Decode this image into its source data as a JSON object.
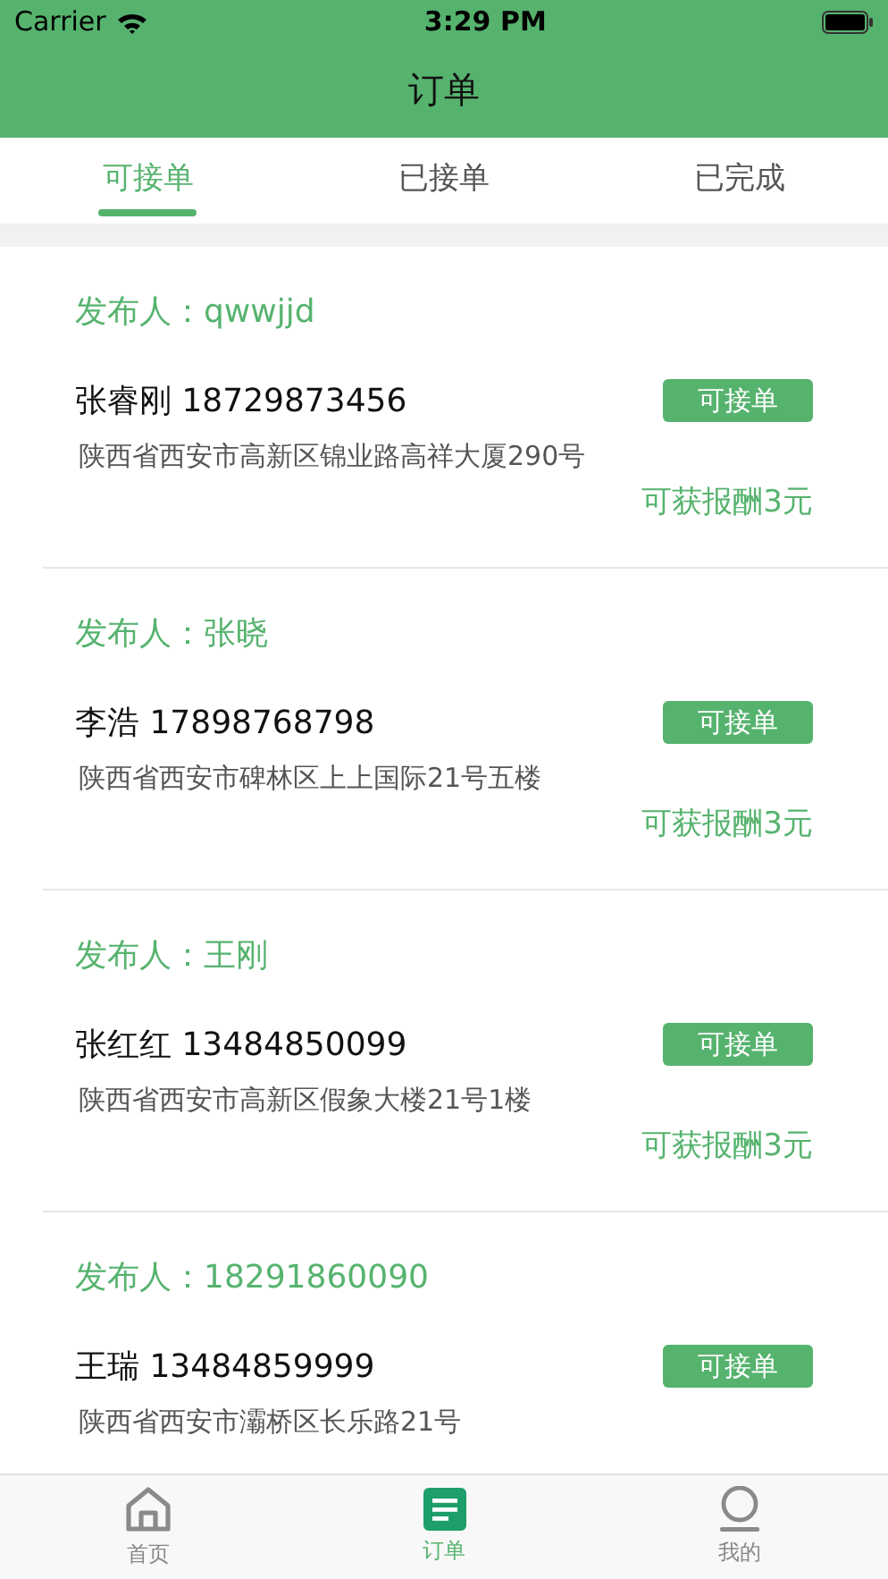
{
  "status_bar": {
    "carrier": "Carrier",
    "time": "3:29 PM"
  },
  "nav": {
    "title": "订单"
  },
  "tabs": [
    {
      "label": "可接单",
      "selected": true
    },
    {
      "label": "已接单",
      "selected": false
    },
    {
      "label": "已完成",
      "selected": false
    }
  ],
  "orders": [
    {
      "publisher": "发布人：qwwjjd",
      "contact": "张睿刚 18729873456",
      "status": "可接单",
      "address": "陕西省西安市高新区锦业路高祥大厦290号",
      "reward": "可获报酬3元"
    },
    {
      "publisher": "发布人：张晓",
      "contact": "李浩 17898768798",
      "status": "可接单",
      "address": "陕西省西安市碑林区上上国际21号五楼",
      "reward": "可获报酬3元"
    },
    {
      "publisher": "发布人：王刚",
      "contact": "张红红 13484850099",
      "status": "可接单",
      "address": "陕西省西安市高新区假象大楼21号1楼",
      "reward": "可获报酬3元"
    },
    {
      "publisher": "发布人：18291860090",
      "contact": "王瑞 13484859999",
      "status": "可接单",
      "address": "陕西省西安市灞桥区长乐路21号"
    }
  ],
  "tab_bar": [
    {
      "kind": "home",
      "label": "首页",
      "selected": false
    },
    {
      "kind": "orders",
      "label": "订单",
      "selected": true
    },
    {
      "kind": "profile",
      "label": "我的",
      "selected": false
    }
  ]
}
